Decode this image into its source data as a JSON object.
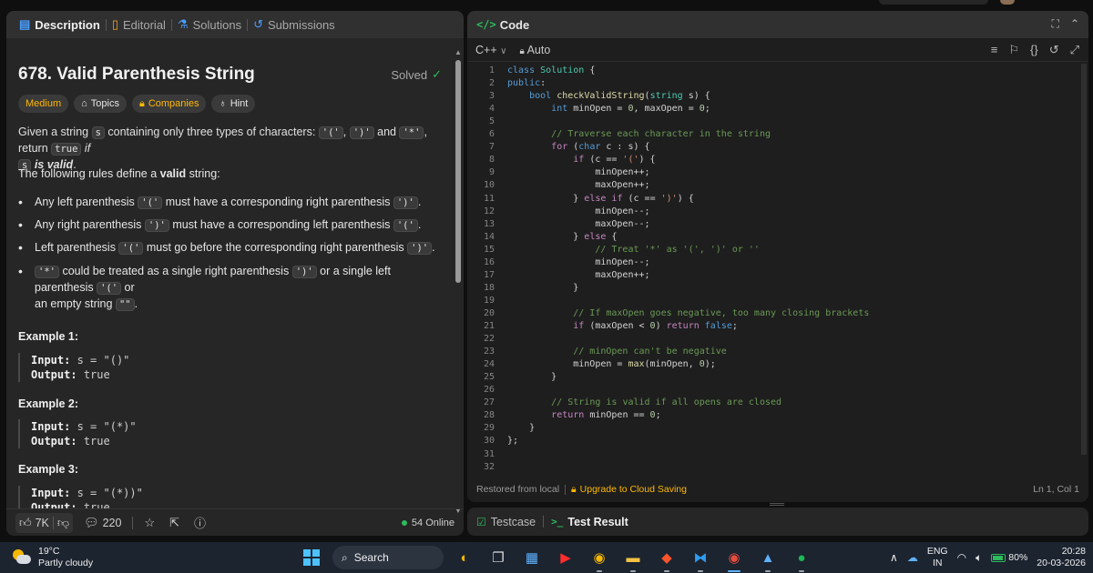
{
  "tabs": [
    {
      "label": "Description",
      "icon": "document-icon"
    },
    {
      "label": "Editorial",
      "icon": "book-icon"
    },
    {
      "label": "Solutions",
      "icon": "flask-icon"
    },
    {
      "label": "Submissions",
      "icon": "history-icon"
    }
  ],
  "problem": {
    "title": "678. Valid Parenthesis String",
    "status": "Solved",
    "chips": [
      "Medium",
      "Topics",
      "Companies",
      "Hint"
    ]
  },
  "description": {
    "p1_a": "Given a string ",
    "p1_s": "s",
    "p1_b": " containing only three types of characters: ",
    "p1_c1": "'('",
    "p1_comma1": ", ",
    "p1_c2": "')'",
    "p1_and": " and ",
    "p1_c3": "'*'",
    "p1_c": ", return ",
    "p1_true": "true",
    "p1_if": "if",
    "p1_s2": "s",
    "p1_valid": "is valid",
    "p1_end": ".",
    "p2_a": "The following rules define a ",
    "p2_valid": "valid",
    "p2_b": " string:",
    "rules": [
      {
        "a": "Any left parenthesis ",
        "code": "'('",
        "b": " must have a corresponding right parenthesis ",
        "code2": "')'",
        "c": "."
      },
      {
        "a": "Any right parenthesis ",
        "code": "')'",
        "b": " must have a corresponding left parenthesis ",
        "code2": "'('",
        "c": "."
      },
      {
        "a": "Left parenthesis ",
        "code": "'('",
        "b": " must go before the corresponding right parenthesis ",
        "code2": "')'",
        "c": "."
      },
      {
        "a": "",
        "code": "'*'",
        "b": " could be treated as a single right parenthesis ",
        "code2": "')'",
        "c": " or a single left parenthesis ",
        "code3": "'('",
        "d": " or",
        "e": "an empty string ",
        "code4": "\"\"",
        "f": "."
      }
    ]
  },
  "examples": [
    {
      "heading": "Example 1:",
      "input_label": "Input:",
      "input": "s = \"()\"",
      "output_label": "Output:",
      "output": "true"
    },
    {
      "heading": "Example 2:",
      "input_label": "Input:",
      "input": "s = \"(*)\"",
      "output_label": "Output:",
      "output": "true"
    },
    {
      "heading": "Example 3:",
      "input_label": "Input:",
      "input": "s = \"(*))\"",
      "output_label": "Output:",
      "output": "true"
    }
  ],
  "footer": {
    "likes": "7K",
    "comments": "220",
    "online": "54 Online"
  },
  "code_panel": {
    "title": "Code",
    "language": "C++",
    "autosave": "Auto",
    "restored": "Restored from local",
    "upgrade": "Upgrade to Cloud Saving",
    "cursor": "Ln 1, Col 1"
  },
  "code_lines": [
    "class Solution {",
    "public:",
    "    bool checkValidString(string s) {",
    "        int minOpen = 0, maxOpen = 0;",
    "",
    "        // Traverse each character in the string",
    "        for (char c : s) {",
    "            if (c == '(') {",
    "                minOpen++;",
    "                maxOpen++;",
    "            } else if (c == ')') {",
    "                minOpen--;",
    "                maxOpen--;",
    "            } else {",
    "                // Treat '*' as '(', ')' or ''",
    "                minOpen--;",
    "                maxOpen++;",
    "            }",
    "",
    "            // If maxOpen goes negative, too many closing brackets",
    "            if (maxOpen < 0) return false;",
    "",
    "            // minOpen can't be negative",
    "            minOpen = max(minOpen, 0);",
    "        }",
    "",
    "        // String is valid if all opens are closed",
    "        return minOpen == 0;",
    "    }",
    "};",
    "",
    ""
  ],
  "line_numbers": [
    "1",
    "2",
    "3",
    "4",
    "5",
    "6",
    "7",
    "8",
    "9",
    "10",
    "11",
    "12",
    "13",
    "14",
    "15",
    "16",
    "17",
    "18",
    "19",
    "20",
    "21",
    "22",
    "23",
    "24",
    "25",
    "26",
    "27",
    "28",
    "29",
    "30",
    "31",
    "32"
  ],
  "test_panel": {
    "testcase": "Testcase",
    "result": "Test Result"
  },
  "taskbar": {
    "temp": "19°C",
    "weather": "Partly cloudy",
    "search": "Search",
    "lang1": "ENG",
    "lang2": "IN",
    "battery": "80%",
    "time": "20:28",
    "date": "20-03-2026"
  },
  "colors": {
    "accent_green": "#2cbb5d",
    "accent_yellow": "#ffb800",
    "link_blue": "#4a9eff"
  }
}
